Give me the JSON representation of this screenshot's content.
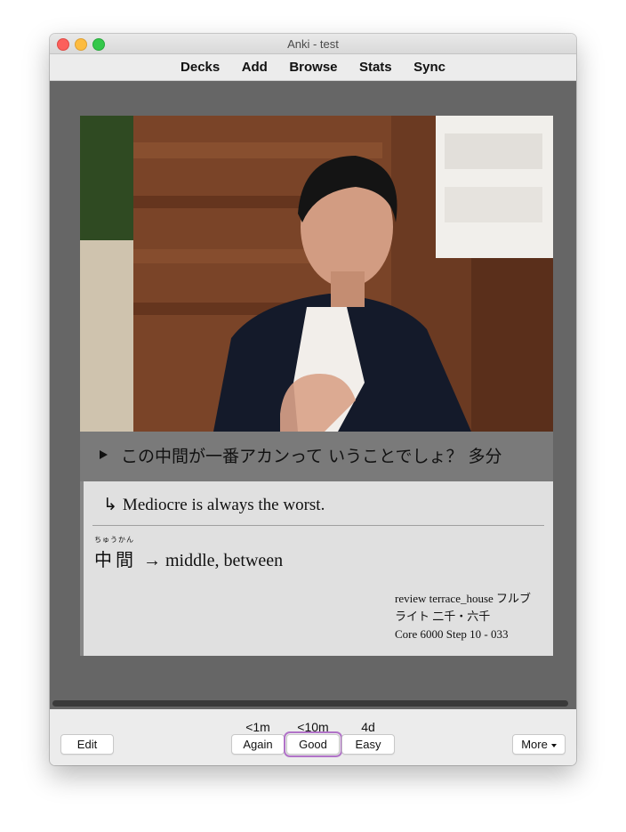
{
  "window": {
    "title": "Anki - test"
  },
  "toolbar": {
    "items": [
      "Decks",
      "Add",
      "Browse",
      "Stats",
      "Sync"
    ]
  },
  "card": {
    "photo_icon": "card-photo",
    "sentence": "この中間が一番アカンって いうことでしょ？ 多分",
    "translation": "Mediocre is always the worst.",
    "vocab": {
      "furigana": "ちゅうかん",
      "kanji": "中間",
      "meaning": "→ middle, between"
    },
    "tags": [
      "review terrace_house フルブ",
      "ライト 二千・六千",
      "Core 6000 Step 10 - 033"
    ]
  },
  "bottom": {
    "edit_label": "Edit",
    "again": {
      "label": "Again",
      "interval": "<1m"
    },
    "good": {
      "label": "Good",
      "interval": "<10m"
    },
    "easy": {
      "label": "Easy",
      "interval": "4d"
    },
    "more_label": "More"
  },
  "colors": {
    "focus_ring": "#b173c8",
    "reviewer_background": "#666666"
  }
}
